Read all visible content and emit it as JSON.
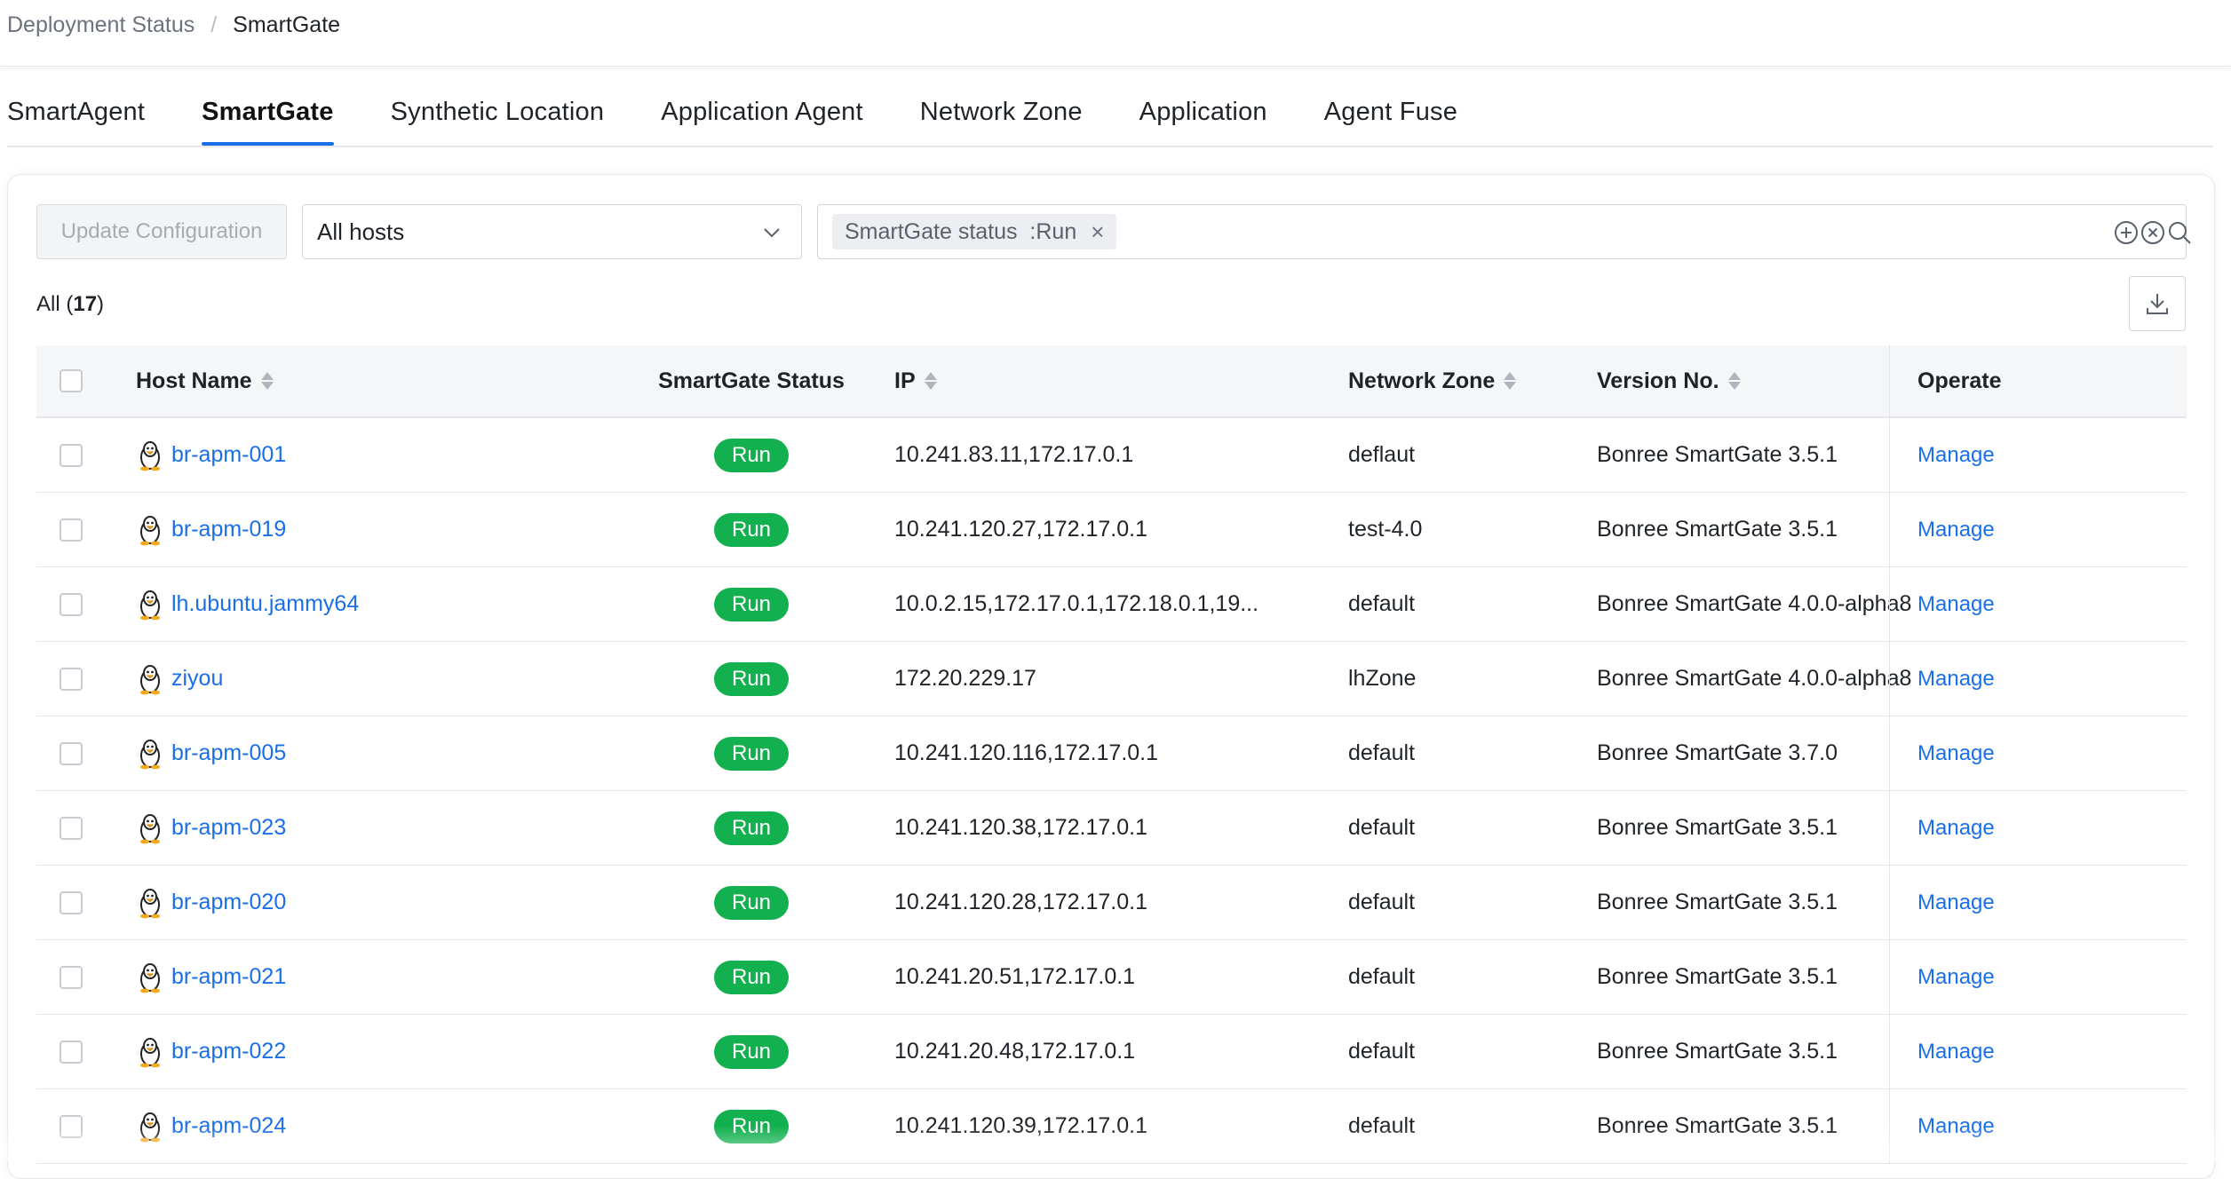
{
  "breadcrumb": {
    "parent": "Deployment Status",
    "separator": "/",
    "current": "SmartGate"
  },
  "tabs": [
    {
      "label": "SmartAgent",
      "active": false
    },
    {
      "label": "SmartGate",
      "active": true
    },
    {
      "label": "Synthetic Location",
      "active": false
    },
    {
      "label": "Application Agent",
      "active": false
    },
    {
      "label": "Network Zone",
      "active": false
    },
    {
      "label": "Application",
      "active": false
    },
    {
      "label": "Agent Fuse",
      "active": false
    }
  ],
  "toolbar": {
    "update_label": "Update Configuration",
    "host_select_value": "All hosts",
    "filter_tag": "SmartGate status  :Run"
  },
  "count": {
    "label": "All",
    "value": "17"
  },
  "table": {
    "headers": {
      "host": "Host Name",
      "status": "SmartGate Status",
      "ip": "IP",
      "zone": "Network Zone",
      "version": "Version No.",
      "operate": "Operate"
    },
    "rows": [
      {
        "host": "br-apm-001",
        "status": "Run",
        "ip": "10.241.83.11,172.17.0.1",
        "zone": "deflaut",
        "version": "Bonree SmartGate 3.5.1",
        "op": "Manage"
      },
      {
        "host": "br-apm-019",
        "status": "Run",
        "ip": "10.241.120.27,172.17.0.1",
        "zone": "test-4.0",
        "version": "Bonree SmartGate 3.5.1",
        "op": "Manage"
      },
      {
        "host": "lh.ubuntu.jammy64",
        "status": "Run",
        "ip": "10.0.2.15,172.17.0.1,172.18.0.1,19...",
        "zone": "default",
        "version": "Bonree SmartGate 4.0.0-alpha8",
        "op": "Manage"
      },
      {
        "host": "ziyou",
        "status": "Run",
        "ip": "172.20.229.17",
        "zone": "lhZone",
        "version": "Bonree SmartGate 4.0.0-alpha8",
        "op": "Manage"
      },
      {
        "host": "br-apm-005",
        "status": "Run",
        "ip": "10.241.120.116,172.17.0.1",
        "zone": "default",
        "version": "Bonree SmartGate 3.7.0",
        "op": "Manage"
      },
      {
        "host": "br-apm-023",
        "status": "Run",
        "ip": "10.241.120.38,172.17.0.1",
        "zone": "default",
        "version": "Bonree SmartGate 3.5.1",
        "op": "Manage"
      },
      {
        "host": "br-apm-020",
        "status": "Run",
        "ip": "10.241.120.28,172.17.0.1",
        "zone": "default",
        "version": "Bonree SmartGate 3.5.1",
        "op": "Manage"
      },
      {
        "host": "br-apm-021",
        "status": "Run",
        "ip": "10.241.20.51,172.17.0.1",
        "zone": "default",
        "version": "Bonree SmartGate 3.5.1",
        "op": "Manage"
      },
      {
        "host": "br-apm-022",
        "status": "Run",
        "ip": "10.241.20.48,172.17.0.1",
        "zone": "default",
        "version": "Bonree SmartGate 3.5.1",
        "op": "Manage"
      },
      {
        "host": "br-apm-024",
        "status": "Run",
        "ip": "10.241.120.39,172.17.0.1",
        "zone": "default",
        "version": "Bonree SmartGate 3.5.1",
        "op": "Manage"
      }
    ]
  },
  "colors": {
    "accent": "#1a6fe8",
    "run_badge": "#12b04f"
  },
  "icons": {
    "host_os": "linux-penguin-icon",
    "select": "chevron-down-icon",
    "filter_actions": [
      "add-circle-icon",
      "clear-circle-icon",
      "search-icon"
    ],
    "export": "download-icon"
  }
}
